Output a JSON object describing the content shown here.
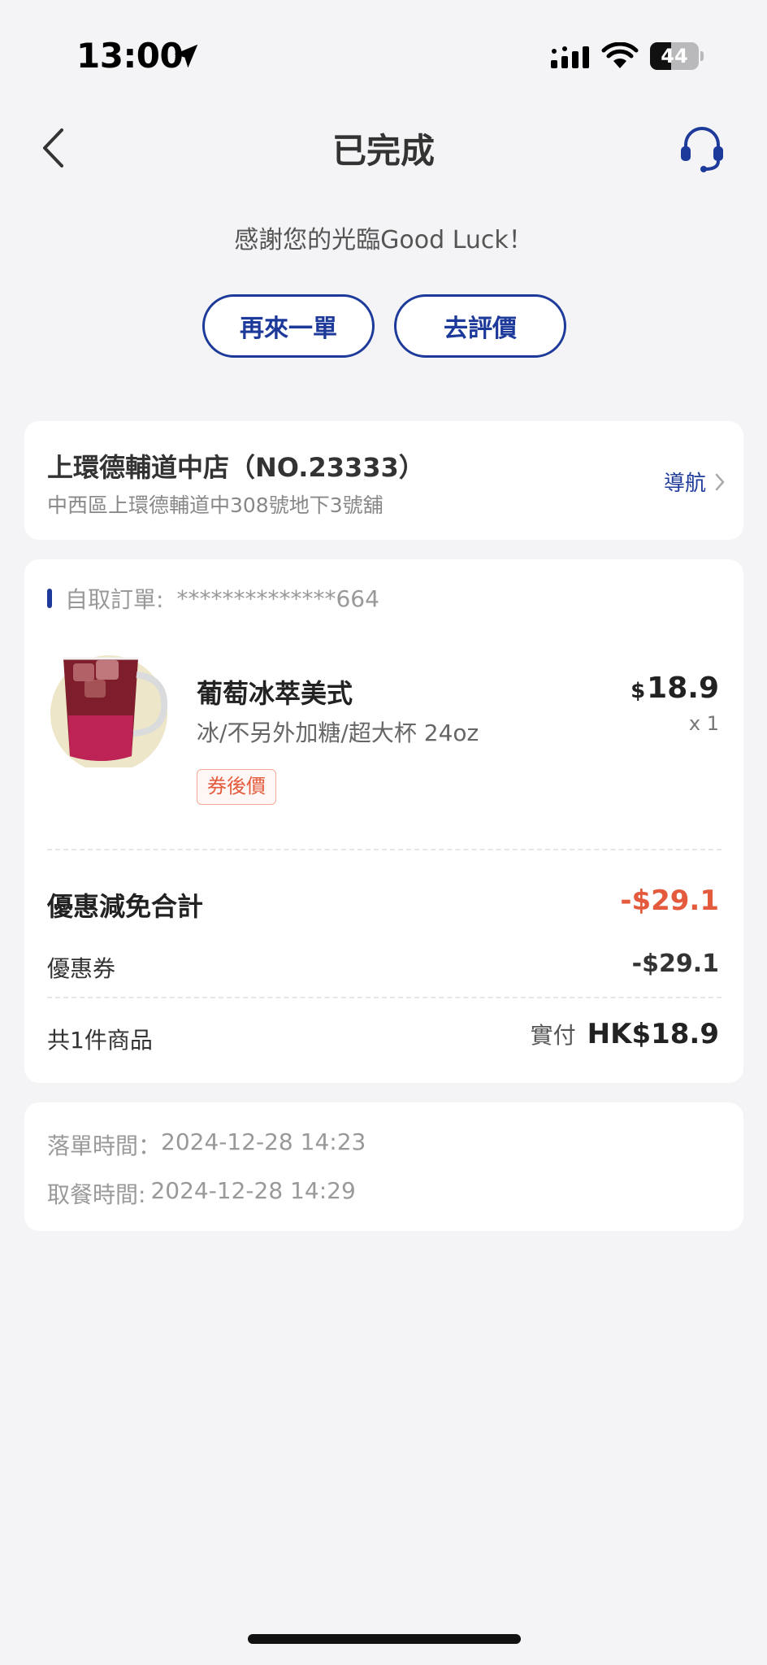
{
  "status_bar": {
    "time": "13:00",
    "battery": "44",
    "battery_level": 0.44
  },
  "nav": {
    "title": "已完成",
    "back_icon": "chevron-left-icon",
    "service_icon": "headset-icon"
  },
  "thanks_text": "感謝您的光臨Good Luck！",
  "actions": {
    "reorder_label": "再來一單",
    "review_label": "去評價"
  },
  "store": {
    "name": "上環德輔道中店（NO.23333）",
    "address": "中西區上環德輔道中308號地下3號舖",
    "nav_label": "導航"
  },
  "order": {
    "type_label": "自取訂單:",
    "order_number": "**************664",
    "item": {
      "name": "葡萄冰萃美式",
      "spec": "冰/不另外加糖/超大杯 24oz",
      "tag": "券後價",
      "price_currency": "$",
      "price": "18.9",
      "qty": "x 1",
      "image_icon": "iced-grape-coffee-image"
    },
    "discount_total_label": "優惠減免合計",
    "discount_total_value": "-$29.1",
    "coupon_label": "優惠券",
    "coupon_value": "-$29.1",
    "items_count_label": "共1件商品",
    "paid_label": "實付",
    "paid_value": "HK$18.9"
  },
  "times": {
    "order_time_label": "落單時間：",
    "order_time_value": "2024-12-28 14:23",
    "pickup_time_label": "取餐時間:",
    "pickup_time_value": " 2024-12-28 14:29"
  },
  "colors": {
    "brand_blue": "#1d3a9a",
    "discount_red": "#e35a3c",
    "background": "#f4f4f6"
  }
}
